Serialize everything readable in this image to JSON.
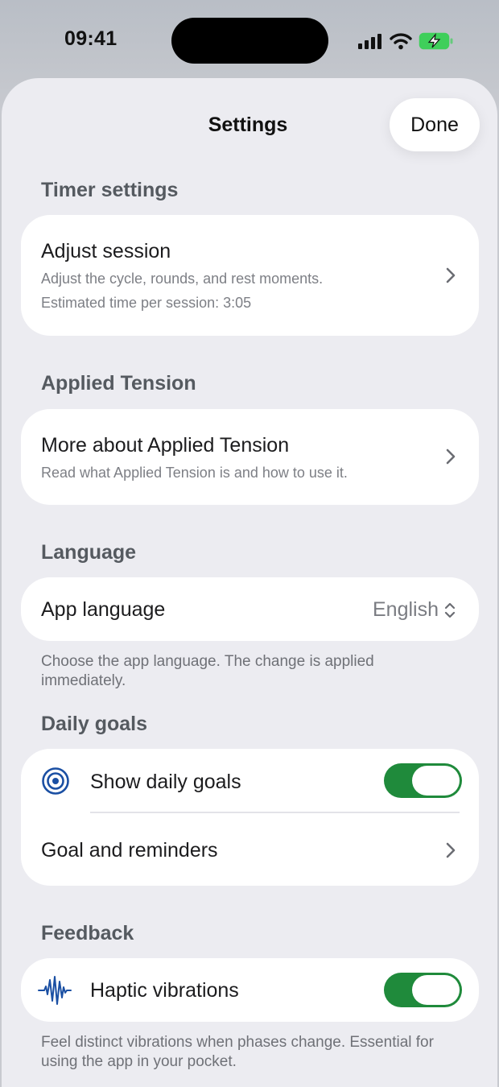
{
  "status": {
    "time": "09:41"
  },
  "header": {
    "title": "Settings",
    "done_label": "Done"
  },
  "timer": {
    "section": "Timer settings",
    "title": "Adjust session",
    "subtitle": "Adjust the cycle, rounds, and rest moments.",
    "estimate": "Estimated time per session: 3:05"
  },
  "tension": {
    "section": "Applied Tension",
    "title": "More about Applied Tension",
    "subtitle": "Read what Applied Tension is and how to use it."
  },
  "language": {
    "section": "Language",
    "label": "App language",
    "value": "English",
    "footnote": "Choose the app language. The change is applied immediately."
  },
  "goals": {
    "section": "Daily goals",
    "show_label": "Show daily goals",
    "show_enabled": true,
    "reminders_label": "Goal and reminders"
  },
  "feedback": {
    "section": "Feedback",
    "haptic_label": "Haptic vibrations",
    "haptic_enabled": true,
    "footnote": "Feel distinct vibrations when phases change. Essential for using the app in your pocket."
  },
  "colors": {
    "accent": "#1f8a3b",
    "icon_blue": "#1a4fa3",
    "background": "#ececf1"
  },
  "icons": [
    "signal-icon",
    "wifi-icon",
    "battery-icon",
    "chevron-right-icon",
    "chevron-updown-icon",
    "target-icon",
    "waveform-icon"
  ]
}
